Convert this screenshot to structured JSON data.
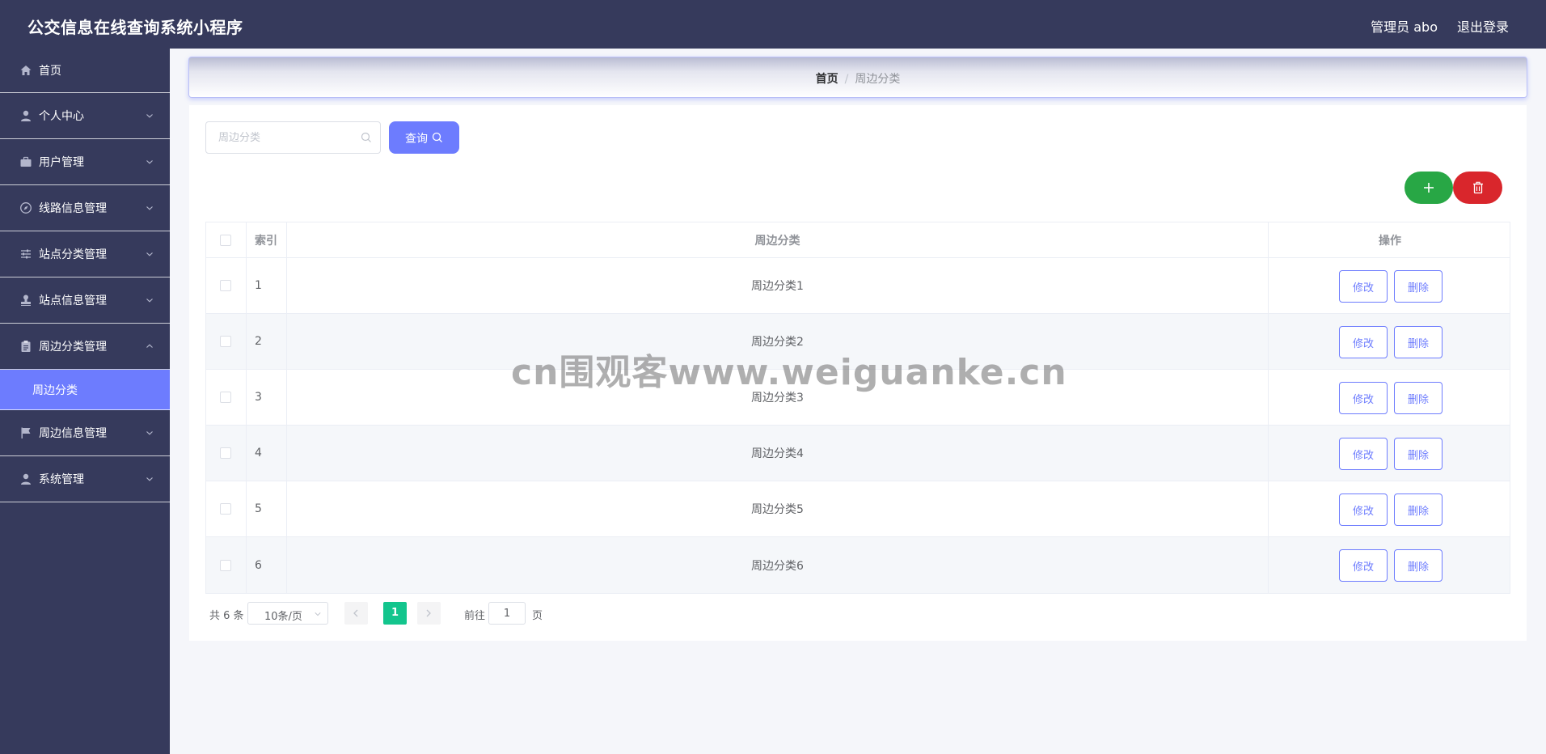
{
  "header": {
    "title": "公交信息在线查询系统小程序",
    "user": "管理员 abo",
    "logout": "退出登录"
  },
  "sidebar": {
    "items": [
      {
        "label": "首页",
        "icon": "home-icon"
      },
      {
        "label": "个人中心",
        "icon": "user-icon"
      },
      {
        "label": "用户管理",
        "icon": "briefcase-icon"
      },
      {
        "label": "线路信息管理",
        "icon": "compass-icon"
      },
      {
        "label": "站点分类管理",
        "icon": "sliders-icon"
      },
      {
        "label": "站点信息管理",
        "icon": "stamp-icon"
      },
      {
        "label": "周边分类管理",
        "icon": "clipboard-icon"
      },
      {
        "label": "周边信息管理",
        "icon": "flag-icon"
      },
      {
        "label": "系统管理",
        "icon": "user-icon"
      }
    ],
    "active_sub": "周边分类"
  },
  "breadcrumb": {
    "home": "首页",
    "separator": "/",
    "current": "周边分类"
  },
  "search": {
    "placeholder": "周边分类",
    "button": "查询"
  },
  "table": {
    "headers": {
      "index": "索引",
      "name": "周边分类",
      "ops": "操作"
    },
    "rows": [
      {
        "index": "1",
        "name": "周边分类1"
      },
      {
        "index": "2",
        "name": "周边分类2"
      },
      {
        "index": "3",
        "name": "周边分类3"
      },
      {
        "index": "4",
        "name": "周边分类4"
      },
      {
        "index": "5",
        "name": "周边分类5"
      },
      {
        "index": "6",
        "name": "周边分类6"
      }
    ],
    "edit_label": "修改",
    "delete_label": "删除"
  },
  "pagination": {
    "total": "共 6 条",
    "page_size": "10条/页",
    "current_page": "1",
    "goto_label": "前往",
    "goto_value": "1",
    "page_label": "页"
  },
  "watermark": "cn围观客www.weiguanke.cn",
  "colors": {
    "primary": "#6d7cfe",
    "sidebar": "#363a5c",
    "add": "#28a745",
    "delete": "#d9262c",
    "page_active": "#13c58d"
  }
}
